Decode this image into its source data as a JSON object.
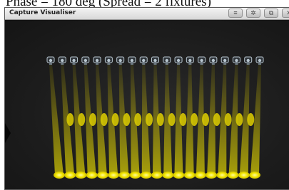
{
  "caption": {
    "text": "Phase = 180 deg (Spread = 2 fixtures)"
  },
  "window": {
    "title": "Capture Visualiser",
    "buttons": [
      {
        "icon": "menu-icon",
        "glyph": "≡"
      },
      {
        "icon": "gear-icon",
        "glyph": "✲"
      },
      {
        "icon": "restore-icon",
        "glyph": "⧉"
      },
      {
        "icon": "close-icon",
        "glyph": "✕"
      }
    ]
  },
  "scene": {
    "fixture_count": 19,
    "beam_color": "#f2e600",
    "fixture_color": "#b8c6cf"
  }
}
